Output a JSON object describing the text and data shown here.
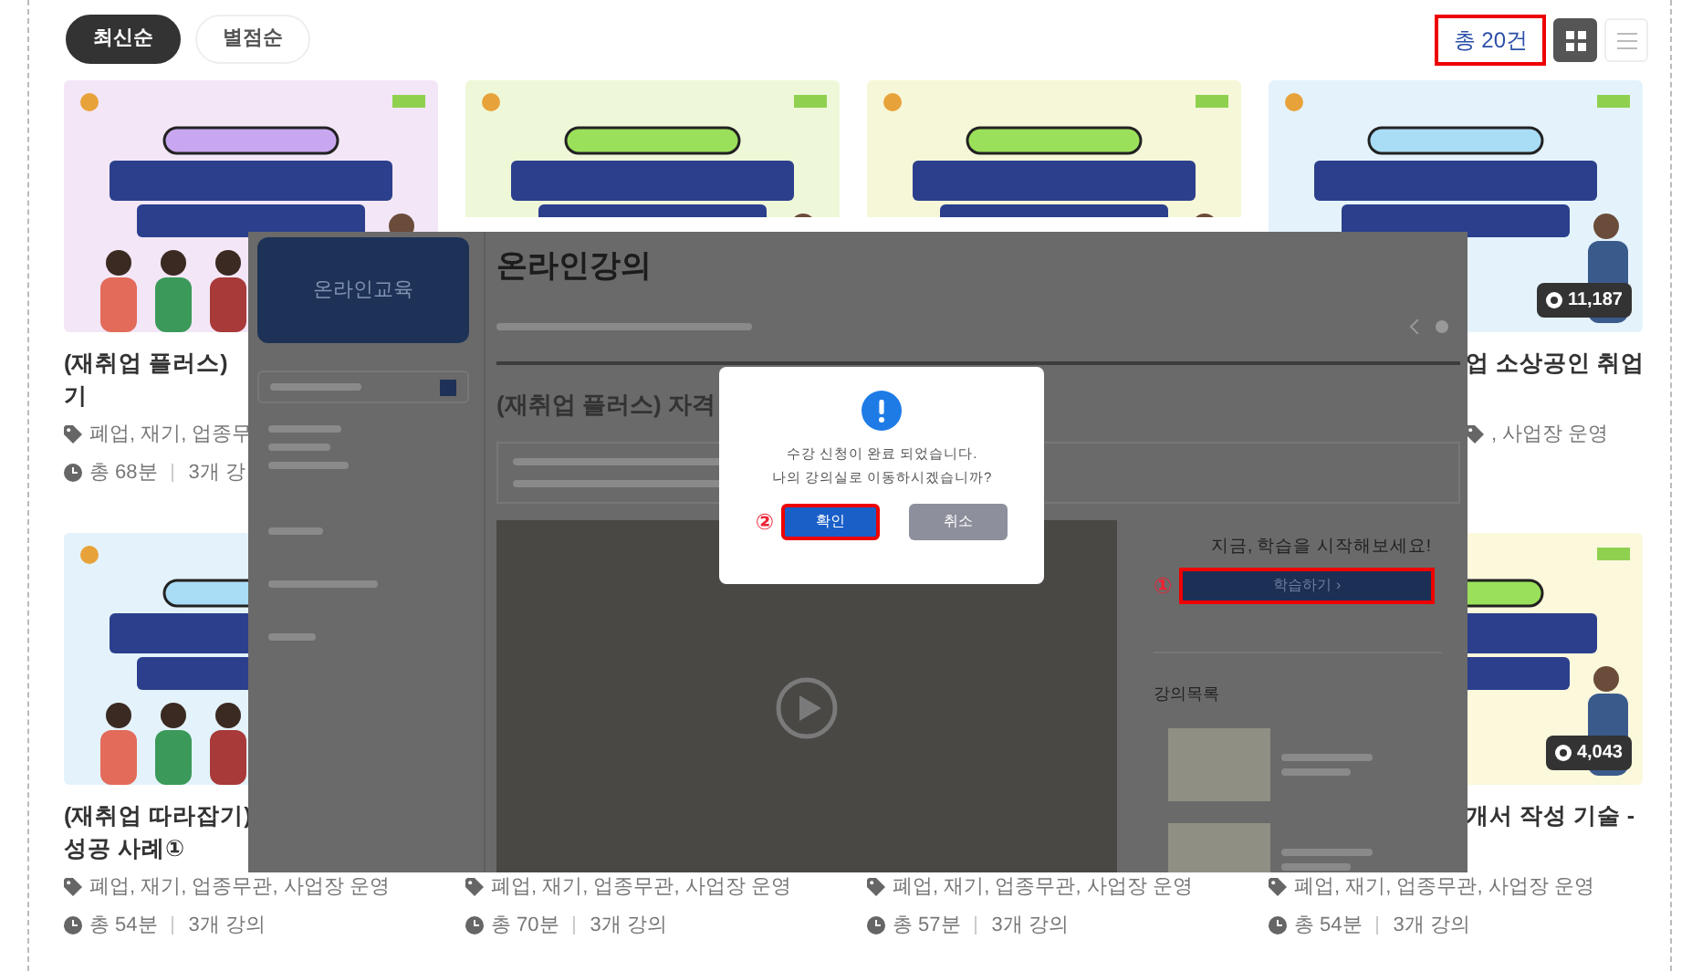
{
  "sort_tabs": [
    {
      "label": "최신순",
      "selected": true
    },
    {
      "label": "별점순",
      "selected": false
    }
  ],
  "total": {
    "text": "총 20건",
    "highlighted": true
  },
  "view_modes": [
    {
      "kind": "grid",
      "selected": true
    },
    {
      "kind": "list",
      "selected": false
    }
  ],
  "courses": [
    {
      "thumbnail": {
        "kind": "picture"
      },
      "title_lines": [
        "(재취업 플러스)",
        "기"
      ],
      "tags": "폐업, 재기, 업종무",
      "duration": "총 68분",
      "lessons": "3개 강"
    },
    {
      "thumbnail": {
        "kind": "picture",
        "lower_part_hidden": true
      }
    },
    {
      "thumbnail": {
        "kind": "picture",
        "lower_part_hidden": true
      }
    },
    {
      "thumbnail": {
        "kind": "picture"
      },
      "views": "11,187",
      "title_cut_start": true,
      "tags_cut_start": true,
      "title_lines": [
        "업 소상공인 취업"
      ],
      "tags": ", 사업장 운영"
    },
    {
      "thumbnail": {
        "kind": "picture"
      },
      "title_lines": [
        "(재취업 따라잡기)",
        "성공 사례①"
      ],
      "tags": "폐업, 재기, 업종무관, 사업장 운영",
      "duration": "총 54분",
      "lessons": "3개 강의"
    },
    {
      "tags": "폐업, 재기, 업종무관, 사업장 운영",
      "duration": "총 70분",
      "lessons": "3개 강의"
    },
    {
      "tags": "폐업, 재기, 업종무관, 사업장 운영",
      "duration": "총 57분",
      "lessons": "3개 강의"
    },
    {
      "thumbnail": {
        "kind": "picture"
      },
      "views": "4,043",
      "title_cut_start": true,
      "title_lines": [
        "개서 작성 기술 -"
      ],
      "tags": "폐업, 재기, 업종무관, 사업장 운영",
      "duration": "총 54분",
      "lessons": "3개 강의"
    }
  ],
  "overlay_screenshot": {
    "sidebar_title": "온라인교육",
    "page_title": "온라인강의",
    "course_title": "(재취업 플러스) 자격",
    "dialog": {
      "message_lines": [
        "수강 신청이 완료 되었습니다.",
        "나의 강의실로 이동하시겠습니까?"
      ],
      "buttons": [
        {
          "label": "확인",
          "kind": "primary",
          "highlighted": true,
          "step": "②"
        },
        {
          "label": "취소",
          "kind": "secondary",
          "highlighted": false
        }
      ]
    },
    "side_panel": {
      "prompt": "지금, 학습을 시작해보세요!",
      "button": {
        "label": "학습하기 ›",
        "highlighted": true,
        "step": "①"
      },
      "list_title": "강의목록"
    }
  }
}
